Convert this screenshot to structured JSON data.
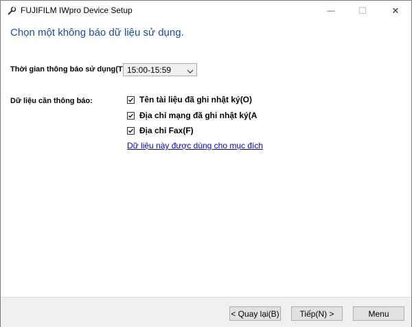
{
  "window": {
    "title": "FUJIFILM IWpro Device Setup",
    "minimize_glyph": "—",
    "maximize_glyph": "☐",
    "close_glyph": "✕"
  },
  "main": {
    "heading": "Chọn một không báo dữ liệu sử dụng.",
    "time_label": "Thời gian thông báo sử dụng(T):",
    "time_value": "15:00-15:59",
    "data_label": "Dữ liệu cần thông báo:",
    "options": [
      {
        "label": "Tên tài liệu đã ghi nhật ký(O)",
        "checked": true
      },
      {
        "label": "Địa chỉ mạng đã ghi nhật ký(A",
        "checked": true
      },
      {
        "label": "Địa chỉ Fax(F)",
        "checked": true
      }
    ],
    "link": "Dữ liệu này được dùng cho mục đích"
  },
  "footer": {
    "back_label": "< Quay lại(B)",
    "next_label": "Tiếp(N) >",
    "menu_label": "Menu"
  },
  "colors": {
    "heading": "#1a4bb3",
    "link": "#0000ee",
    "footer_bg": "#f0f0f0"
  },
  "icons": [
    "settings-wrench-icon",
    "minimize-icon",
    "maximize-icon",
    "close-icon",
    "chevron-down-icon",
    "checkmark-icon"
  ]
}
